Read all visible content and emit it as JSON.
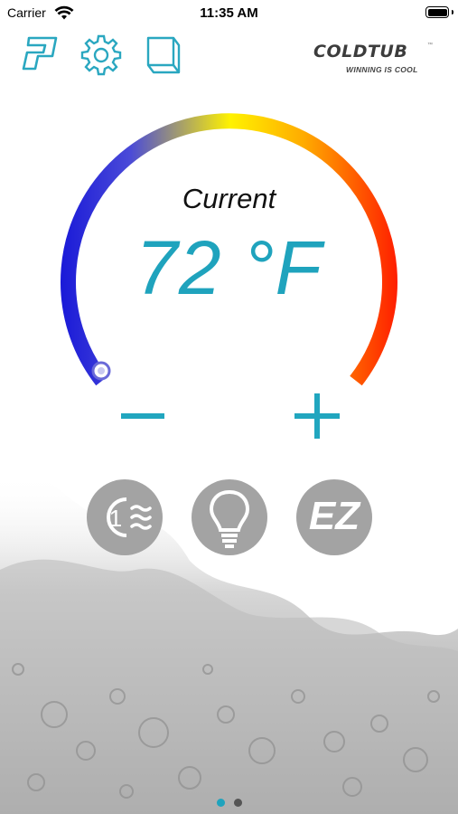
{
  "status_bar": {
    "carrier": "Carrier",
    "time": "11:35 AM"
  },
  "toolbar": {
    "items": [
      {
        "icon": "p-logo-icon"
      },
      {
        "icon": "gear-icon"
      },
      {
        "icon": "book-icon"
      }
    ]
  },
  "logo": {
    "brand": "COLDTUB",
    "tm": "™",
    "tagline": "WINNING IS COOL"
  },
  "thermostat": {
    "label": "Current",
    "temperature": "72 °F",
    "gradient_colors": [
      "#1b1bd8",
      "#fff200",
      "#ff1e00"
    ],
    "handle_position": "min"
  },
  "controls": {
    "minus": {
      "icon": "minus-icon"
    },
    "plus": {
      "icon": "plus-icon"
    }
  },
  "mode_buttons": [
    {
      "icon": "jet-wave-icon",
      "label": "1"
    },
    {
      "icon": "light-bulb-icon"
    },
    {
      "icon": "ez-icon",
      "label": "EZ"
    }
  ],
  "pagination": {
    "pages": 2,
    "current": 1
  },
  "colors": {
    "accent": "#1fa3bd",
    "button_gray": "#a3a3a3"
  }
}
